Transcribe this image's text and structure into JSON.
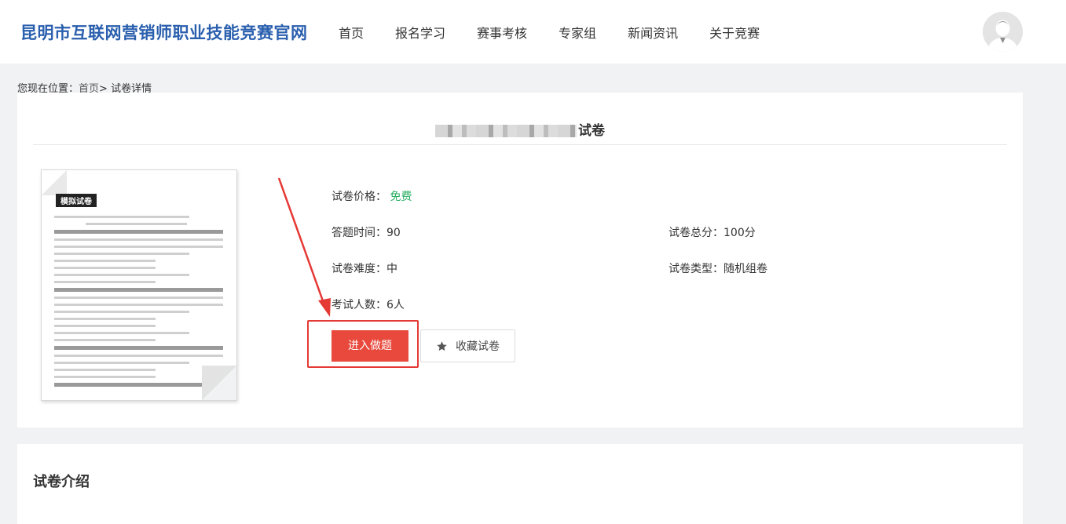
{
  "header": {
    "site_title": "昆明市互联网营销师职业技能竞赛官网",
    "nav": [
      "首页",
      "报名学习",
      "赛事考核",
      "专家组",
      "新闻资讯",
      "关于竞赛"
    ]
  },
  "breadcrumb": {
    "prefix": "您现在位置：",
    "home": "首页",
    "sep": ">",
    "current": "试卷详情"
  },
  "paper": {
    "title_suffix": "试卷",
    "thumb_badge": "模拟试卷",
    "price_label": "试卷价格：",
    "price_value": "免费",
    "duration": "答题时间：90",
    "total_score": "试卷总分：100分",
    "difficulty": "试卷难度：中",
    "paper_type": "试卷类型：随机组卷",
    "examinees": "考试人数：6人",
    "enter_button": "进入做题",
    "favorite_button": "收藏试卷",
    "favorite_icon": "star-icon",
    "price_color": "#27ae60",
    "accent_color": "#e8493c"
  },
  "intro": {
    "title": "试卷介绍"
  }
}
